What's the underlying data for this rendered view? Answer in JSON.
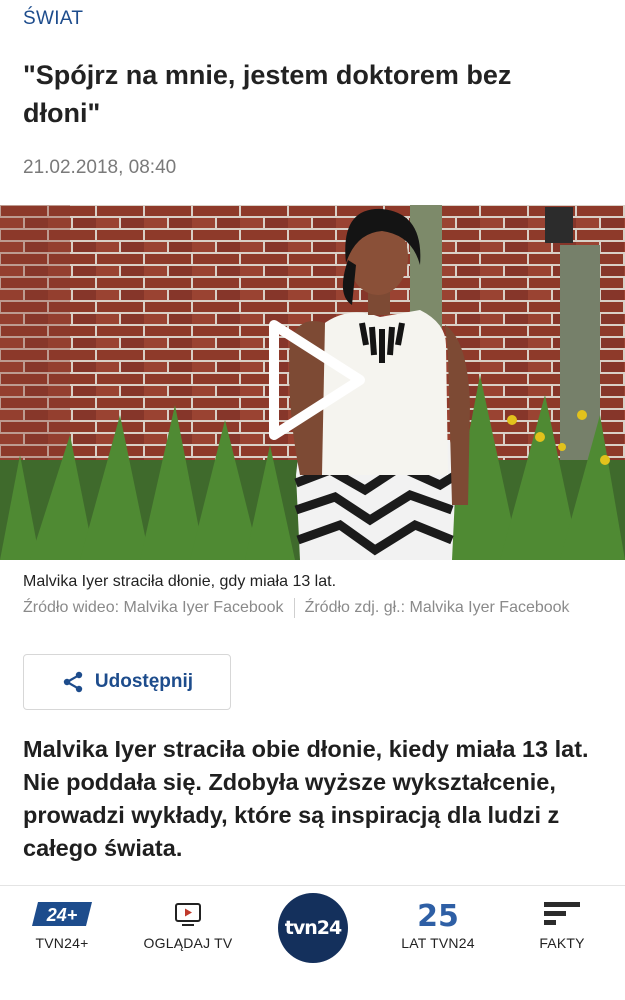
{
  "article": {
    "section": "ŚWIAT",
    "headline": "\"Spójrz na mnie, jestem doktorem bez dłoni\"",
    "date": "21.02.2018, 08:40",
    "caption": "Malvika Iyer straciła dłonie, gdy miała 13 lat.",
    "source_video": "Źródło wideo: Malvika Iyer Facebook",
    "source_photo": "Źródło zdj. gł.: Malvika Iyer Facebook",
    "share_label": "Udostępnij",
    "lead": "Malvika Iyer straciła obie dłonie, kiedy miała 13 lat. Nie poddała się. Zdobyła wyższe wykształcenie, prowadzi wykłady, które są inspiracją dla ludzi z całego świata."
  },
  "media": {
    "type": "video",
    "play_icon": "play-icon"
  },
  "bottom_nav": {
    "items": [
      {
        "label": "TVN24+",
        "icon": "tvn24-plus-icon",
        "badge": "24+"
      },
      {
        "label": "OGLĄDAJ TV",
        "icon": "tv-play-icon"
      },
      {
        "label": "",
        "icon": "tvn24-logo",
        "logo_text": "tvn24"
      },
      {
        "label": "LAT TVN24",
        "icon": "25-years-icon",
        "badge": "25"
      },
      {
        "label": "FAKTY",
        "icon": "fakty-icon"
      }
    ]
  },
  "colors": {
    "accent": "#1d4c8c",
    "logo_bg": "#14305c",
    "text": "#1a1a1a",
    "muted": "#7a7a7a"
  }
}
